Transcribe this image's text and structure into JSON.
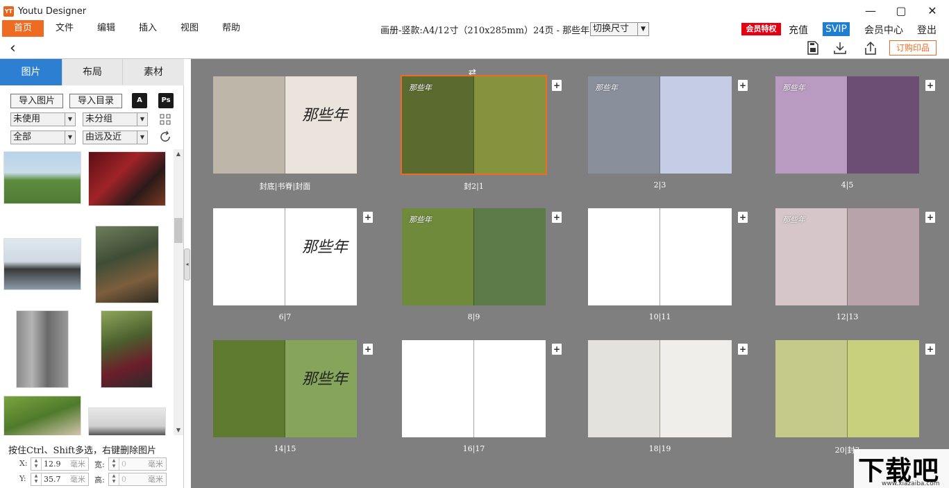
{
  "app": {
    "logo_text": "YT",
    "title": "Youtu Designer"
  },
  "window_controls": {
    "minimize": "—",
    "maximize": "▢",
    "close": "✕"
  },
  "menu": {
    "items": [
      "首页",
      "文件",
      "编辑",
      "插入",
      "视图",
      "帮助"
    ],
    "active_index": 0
  },
  "document": {
    "info": "画册-竖款:A4/12寸（210x285mm）24页 - 那些年",
    "size_button": "切换尺寸"
  },
  "account": {
    "vip_badge": "会员特权",
    "recharge": "充值",
    "svip": "SVIP",
    "member_center": "会员中心",
    "logout": "登出"
  },
  "toolbar": {
    "back": "‹",
    "order_button": "订购印品"
  },
  "sidebar": {
    "tabs": [
      "图片",
      "布局",
      "素材"
    ],
    "active_tab": 0,
    "import_photos": "导入图片",
    "import_folder": "导入目录",
    "acrobat_icon": "A",
    "ps_icon": "Ps",
    "filter_used": "未使用",
    "filter_group": "未分组",
    "filter_all": "全部",
    "sort_order": "由远及近",
    "hint": "按住Ctrl、Shift多选，右键删除图片",
    "x_label": "X:",
    "x_value": "12.9",
    "y_label": "Y:",
    "y_value": "35.7",
    "w_label": "宽:",
    "w_value": "0",
    "h_label": "高:",
    "h_value": "0",
    "unit": "毫米"
  },
  "spreads": [
    {
      "label": "封底|书脊|封面",
      "left": "#bfb6aa",
      "right": "#eae4dc",
      "title_text": "那些年",
      "selected": false
    },
    {
      "label": "封2|1",
      "left": "#5b6b2f",
      "right": "#86923e",
      "title_text": "那些年",
      "selected": true
    },
    {
      "label": "2|3",
      "left": "#8a8f9c",
      "right": "#c4cce6",
      "title_text": "那些年",
      "selected": false
    },
    {
      "label": "4|5",
      "left": "#b99ac0",
      "right": "#6c4d73",
      "title_text": "那些年",
      "selected": false
    },
    {
      "label": "6|7",
      "left": "#ffffff",
      "right": "#ffffff",
      "title_text": "那些年",
      "selected": false
    },
    {
      "label": "8|9",
      "left": "#6f8a3a",
      "right": "#5c7b48",
      "title_text": "那些年",
      "selected": false
    },
    {
      "label": "10|11",
      "left": "#ffffff",
      "right": "#ffffff",
      "title_text": "",
      "selected": false
    },
    {
      "label": "12|13",
      "left": "#d6c6c9",
      "right": "#b9a3aa",
      "title_text": "那些年",
      "selected": false
    },
    {
      "label": "14|15",
      "left": "#5e7a2e",
      "right": "#86a55a",
      "title_text": "那些年",
      "selected": false
    },
    {
      "label": "16|17",
      "left": "#ffffff",
      "right": "#ffffff",
      "title_text": "",
      "selected": false
    },
    {
      "label": "18|19",
      "left": "#e4e2dc",
      "right": "#efeeea",
      "title_text": "",
      "selected": false
    },
    {
      "label": "20|封3",
      "left": "#c5c98a",
      "right": "#c8cf7d",
      "title_text": "",
      "selected": false
    }
  ],
  "watermark": {
    "big": "下载吧",
    "small": "www.xiazaiba.com"
  }
}
